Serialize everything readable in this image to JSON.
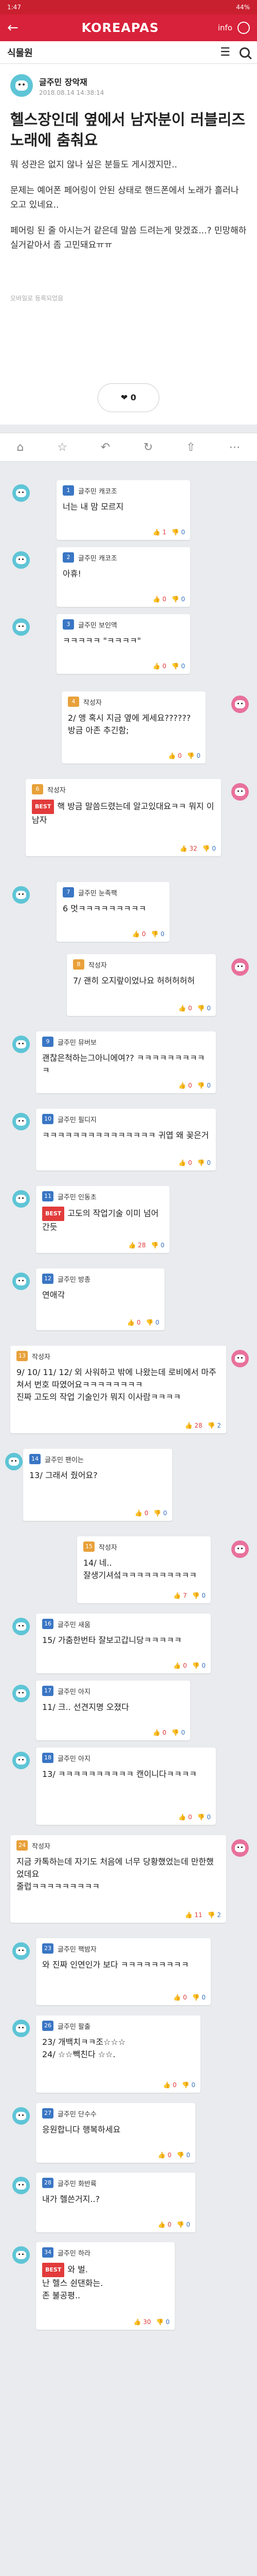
{
  "status": {
    "time": "1:47",
    "right": "44%"
  },
  "header": {
    "back": "←",
    "logo": "KOREAPAS",
    "info": "info"
  },
  "subbar": {
    "board": "식물원",
    "menu": "☰"
  },
  "post": {
    "author": "글주민 장악재",
    "date": "2018.08.14 14:38:14",
    "title": "헬스장인데 옆에서 남자분이 러블리즈 노래에 춤춰요",
    "body": [
      "뭐 성관은 없지 않나 싶은 분들도 게시겠지만..",
      "문제는 예어폰 페어링이 안된 상태로 핸드폰에서 노래가 흘러나오고 있네요..",
      "페어링 된 줄 아시는거 같은데 말씀 드려는게 맞겠죠...? 민망해하실거같아서 좀 고민돼요ㅠㅠ"
    ],
    "source": "모바일로 등록되었음",
    "likes": "0"
  },
  "actionbar": [
    "⌂",
    "☆",
    "↶",
    "↻",
    "⇧",
    "⋯"
  ],
  "comments": [
    {
      "num": "1",
      "name": "글주민 캐코조",
      "text": "너는 내 맘 모르지",
      "up": "1",
      "down": "0",
      "pink": false
    },
    {
      "num": "2",
      "name": "글주민 캐코조",
      "text": "아휴!",
      "up": "0",
      "down": "0",
      "pink": false
    },
    {
      "num": "3",
      "name": "글주민 보인액",
      "text": "ㅋㅋㅋㅋㅋ \"ㅋㅋㅋㅋ\"",
      "up": "0",
      "down": "0",
      "pink": false
    },
    {
      "num": "4",
      "name": "작성자",
      "text": "2/ 앵 혹시 지금 옆에 게세요?????? 방금 아존 추긴함;",
      "up": "0",
      "down": "0",
      "pink": true,
      "orange": true
    },
    {
      "num": "6",
      "name": "작성자",
      "text": "핵 방금 말씀드렸는데 알고있대요ㅋㅋ 뭐지 이 남자",
      "best": "BEST",
      "up": "32",
      "down": "0",
      "pink": true,
      "orange": true
    },
    {
      "num": "7",
      "name": "글주민 눈족팩",
      "text": "6 멋ㅋㅋㅋㅋㅋㅋㅋㅋㅋ",
      "up": "0",
      "down": "0",
      "pink": false
    },
    {
      "num": "8",
      "name": "작성자",
      "text": "7/ 괜히 오지랖이었나요 허허허허허",
      "up": "0",
      "down": "0",
      "pink": true,
      "orange": true
    },
    {
      "num": "9",
      "name": "글주민 뮤버보",
      "text": "괜찮은척하는그아니에여?? ㅋㅋㅋㅋㅋㅋㅋㅋㅋㅋ",
      "up": "0",
      "down": "0",
      "pink": false
    },
    {
      "num": "10",
      "name": "글주민 필디지",
      "text": "ㅋㅋㅋㅋㅋㅋㅋㅋㅋㅋㅋㅋㅋㅋㅋ 귀엽 왜 꽂은거",
      "up": "0",
      "down": "0",
      "pink": false
    },
    {
      "num": "11",
      "name": "글주민 인동초",
      "text": "고도의 작업기술 이미 넘어간듯",
      "best": "BEST",
      "up": "28",
      "down": "0",
      "pink": false
    },
    {
      "num": "12",
      "name": "글주민 방총",
      "text": "연애각",
      "up": "0",
      "down": "0",
      "pink": false
    },
    {
      "num": "13",
      "name": "작성자",
      "text": "9/ 10/ 11/ 12/ 외 사워하고 밖에 나왔는데 로비에서 마주쳐서 번호 따였어요ㅋㅋㅋㅋㅋㅋㅋㅋ\n진짜 고도의 작업 기술인가 뭐지 이사람ㅋㅋㅋㅋ",
      "up": "28",
      "down": "2",
      "pink": true,
      "orange": true
    },
    {
      "num": "14",
      "name": "글주민 팬이는",
      "text": "13/ 그래서 줬어요?",
      "up": "0",
      "down": "0",
      "pink": false
    },
    {
      "num": "15",
      "name": "작성자",
      "text": "14/ 네..\n잘생기셔섴ㅋㅋㅋㅋㅋㅋㅋㅋㅋㅋ",
      "up": "7",
      "down": "0",
      "pink": true,
      "orange": true
    },
    {
      "num": "16",
      "name": "글주민 새움",
      "text": "15/ 가춤한번타 잘보고갑니당ㅋㅋㅋㅋㅋ",
      "up": "0",
      "down": "0",
      "pink": false
    },
    {
      "num": "17",
      "name": "글주민 아지",
      "text": "11/ 크.. 선견지명 오졌다",
      "up": "0",
      "down": "0",
      "pink": false
    },
    {
      "num": "18",
      "name": "글주민 아지",
      "text": "13/ ㅋㅋㅋㅋㅋㅋㅋㅋㅋㅋ 캔이니다ㅋㅋㅋㅋ",
      "up": "0",
      "down": "0",
      "pink": false
    },
    {
      "num": "24",
      "name": "작성자",
      "text": "지금 카톡하는데 자기도 처음에 너무 당황했었는데 만한했었데요\n줄럽ㅋㅋㅋㅋㅋㅋㅋㅋㅋ",
      "up": "11",
      "down": "2",
      "pink": true,
      "orange": true
    },
    {
      "num": "23",
      "name": "글주민 팩밤자",
      "text": "와 진짜 인연인가 보다 ㅋㅋㅋㅋㅋㅋㅋㅋㅋ",
      "up": "0",
      "down": "0",
      "pink": false
    },
    {
      "num": "26",
      "name": "글주민 팔출",
      "text": "23/ 개백치ㅋㅋ조☆☆☆\n24/ ☆☆빽친다 ☆☆.",
      "up": "0",
      "down": "0",
      "pink": false
    },
    {
      "num": "27",
      "name": "글주민 단수수",
      "text": "응원합니다 행복하세요",
      "up": "0",
      "down": "0",
      "pink": false
    },
    {
      "num": "28",
      "name": "글주민 화반륙",
      "text": "내가 헬쓴거지..?",
      "up": "0",
      "down": "0",
      "pink": false
    },
    {
      "num": "34",
      "name": "글주민 하라",
      "text": "와 벌.\n난 헬스 쉰댄화는.\n존 불공평..",
      "best": "BEST",
      "up": "30",
      "down": "0",
      "pink": false
    }
  ]
}
